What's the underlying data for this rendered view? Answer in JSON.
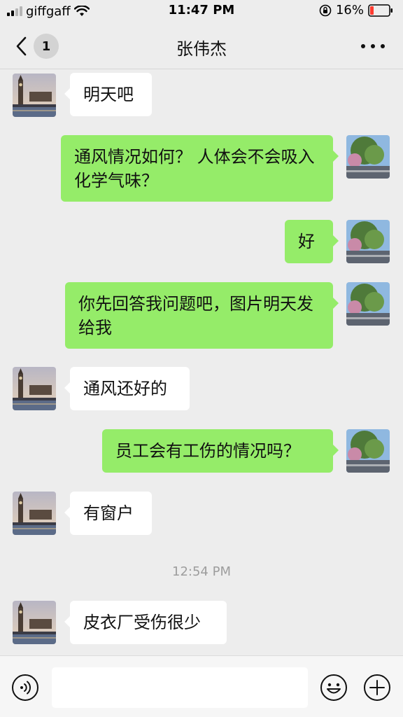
{
  "status_bar": {
    "carrier": "giffgaff",
    "time": "11:47 PM",
    "battery": "16%",
    "battery_color": "#ff3b30"
  },
  "nav": {
    "unread_count": "1",
    "title": "张伟杰"
  },
  "messages": [
    {
      "side": "in",
      "text": "明天吧"
    },
    {
      "side": "out",
      "text": "通风情况如何？ 人体会不会吸入化学气味？"
    },
    {
      "side": "out",
      "text": "好"
    },
    {
      "side": "out",
      "text": "你先回答我问题吧，图片明天发给我"
    },
    {
      "side": "in",
      "text": "通风还好的"
    },
    {
      "side": "out",
      "text": "员工会有工伤的情况吗？"
    },
    {
      "side": "in",
      "text": "有窗户"
    },
    {
      "side": "in",
      "text": "皮衣厂受伤很少"
    }
  ],
  "timestamp": "12:54 PM",
  "input": {
    "value": "",
    "placeholder": ""
  },
  "icons": {
    "back": "chevron-left-icon",
    "more": "more-dots-icon",
    "voice": "voice-icon",
    "emoji": "emoji-icon",
    "plus": "plus-icon"
  },
  "colors": {
    "outgoing_bubble": "#95ec69",
    "incoming_bubble": "#ffffff",
    "background": "#ededed"
  }
}
